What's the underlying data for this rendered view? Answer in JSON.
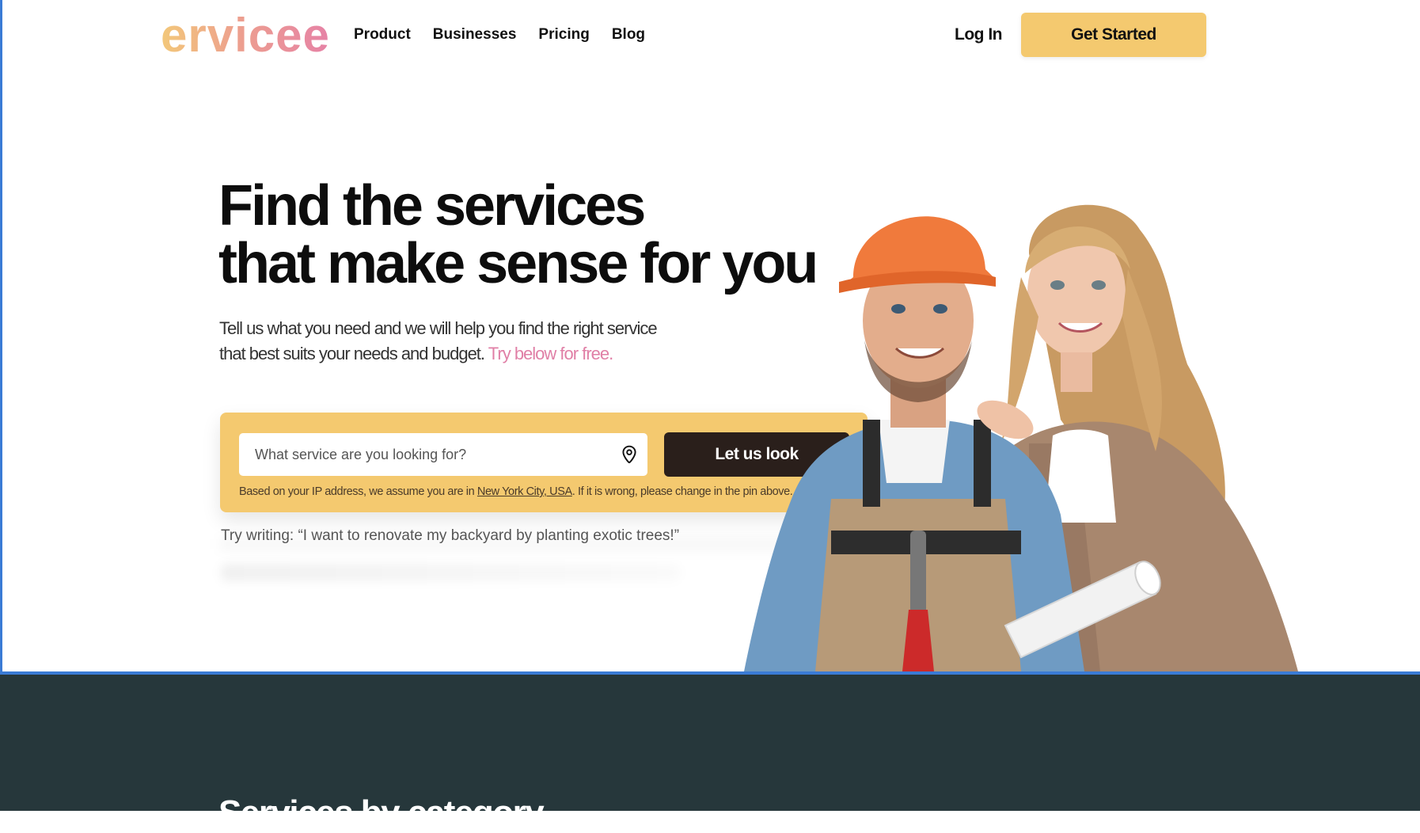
{
  "brand": {
    "logo_text": "ervicee"
  },
  "nav": {
    "items": [
      {
        "label": "Product"
      },
      {
        "label": "Businesses"
      },
      {
        "label": "Pricing"
      },
      {
        "label": "Blog"
      }
    ]
  },
  "header": {
    "login_label": "Log In",
    "cta_label": "Get Started"
  },
  "hero": {
    "title_line1": "Find the services",
    "title_line2": "that make sense for you",
    "subtitle_line1": "Tell us what you need and we will help you find the right service",
    "subtitle_line2": "that best suits your needs and budget.",
    "subtitle_accent": "Try below for free."
  },
  "search": {
    "placeholder": "What service are you looking for?",
    "value": "",
    "button_label": "Let us look",
    "ip_note_prefix": "Based on your IP address, we assume you are in ",
    "location": "New York City, USA",
    "ip_note_suffix": ". If it is wrong, please change in the pin above.",
    "pin_icon": "map-pin-icon"
  },
  "suggestion": {
    "text": "Try writing: “I want to renovate my backyard by planting exotic trees!”"
  },
  "categories": {
    "title": "Services by category"
  },
  "colors": {
    "accent_yellow": "#f4c96f",
    "accent_pink": "#e07fa6",
    "dark_button": "#2a1f1b",
    "dark_section": "#26373b",
    "frame_blue": "#3a7bd5"
  }
}
